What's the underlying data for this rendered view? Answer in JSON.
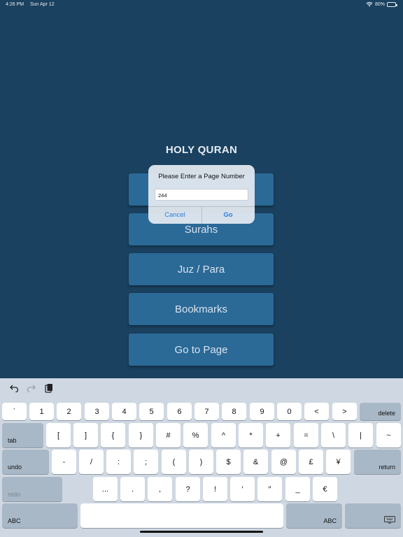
{
  "status_bar": {
    "time": "4:26 PM",
    "date": "Sun Apr 12",
    "battery": "80%"
  },
  "app": {
    "title": "HOLY QURAN"
  },
  "menu": [
    "",
    "Surahs",
    "Juz / Para",
    "Bookmarks",
    "Go to Page"
  ],
  "dialog": {
    "title": "Please Enter a Page Number",
    "input_value": "244",
    "cancel_label": "Cancel",
    "go_label": "Go"
  },
  "keyboard": {
    "row1": [
      "`",
      "1",
      "2",
      "3",
      "4",
      "5",
      "6",
      "7",
      "8",
      "9",
      "0",
      "<",
      ">"
    ],
    "delete": "delete",
    "tab": "tab",
    "row2": [
      "[",
      "]",
      "{",
      "}",
      "#",
      "%",
      "^",
      "*",
      "+",
      "=",
      "\\",
      "|",
      "~"
    ],
    "undo": "undo",
    "row3": [
      "-",
      "/",
      ":",
      ";",
      "(",
      ")",
      "$",
      "&",
      "@",
      "£",
      "¥"
    ],
    "return": "return",
    "redo": "redo",
    "row4": [
      "...",
      ".",
      ",",
      "?",
      "!",
      "′",
      "″",
      "_",
      "€"
    ],
    "abc_left": "ABC",
    "abc_right": "ABC"
  },
  "icons": {
    "undo": "undo-icon",
    "redo": "redo-icon",
    "paste": "paste-icon",
    "hide_keyboard": "keyboard-icon"
  },
  "colors": {
    "background": "#1a415f",
    "button": "#2b6997",
    "keyboard": "#cfd8e2",
    "accent": "#2c7de0"
  }
}
